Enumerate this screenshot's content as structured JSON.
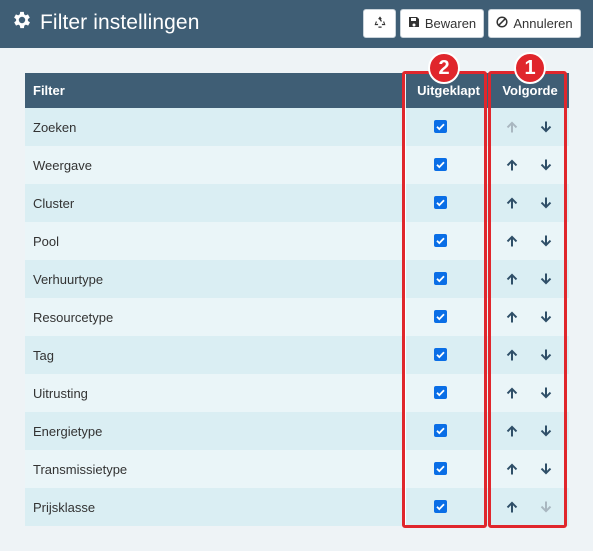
{
  "header": {
    "title": "Filter instellingen",
    "buttons": {
      "save": "Bewaren",
      "cancel": "Annuleren"
    }
  },
  "table": {
    "columns": {
      "filter": "Filter",
      "expanded": "Uitgeklapt",
      "order": "Volgorde"
    },
    "rows": [
      {
        "name": "Zoeken",
        "expanded": true,
        "up_enabled": false,
        "down_enabled": true
      },
      {
        "name": "Weergave",
        "expanded": true,
        "up_enabled": true,
        "down_enabled": true
      },
      {
        "name": "Cluster",
        "expanded": true,
        "up_enabled": true,
        "down_enabled": true
      },
      {
        "name": "Pool",
        "expanded": true,
        "up_enabled": true,
        "down_enabled": true
      },
      {
        "name": "Verhuurtype",
        "expanded": true,
        "up_enabled": true,
        "down_enabled": true
      },
      {
        "name": "Resourcetype",
        "expanded": true,
        "up_enabled": true,
        "down_enabled": true
      },
      {
        "name": "Tag",
        "expanded": true,
        "up_enabled": true,
        "down_enabled": true
      },
      {
        "name": "Uitrusting",
        "expanded": true,
        "up_enabled": true,
        "down_enabled": true
      },
      {
        "name": "Energietype",
        "expanded": true,
        "up_enabled": true,
        "down_enabled": true
      },
      {
        "name": "Transmissietype",
        "expanded": true,
        "up_enabled": true,
        "down_enabled": true
      },
      {
        "name": "Prijsklasse",
        "expanded": true,
        "up_enabled": true,
        "down_enabled": false
      }
    ]
  },
  "annotations": {
    "order_badge": "1",
    "expanded_badge": "2"
  },
  "colors": {
    "header_bg": "#3f5e75",
    "row_odd": "#daeef3",
    "row_even": "#eaf5f8",
    "checkbox": "#0a6ee6",
    "arrow_enabled": "#2f4f68",
    "arrow_disabled": "#a9b7c0",
    "highlight": "#e0262c"
  },
  "icons": {
    "title": "gear-icon",
    "recycle_button": "recycle-icon",
    "save_button": "floppy-disk-icon",
    "cancel_button": "ban-icon",
    "move_up": "arrow-up-icon",
    "move_down": "arrow-down-icon"
  }
}
